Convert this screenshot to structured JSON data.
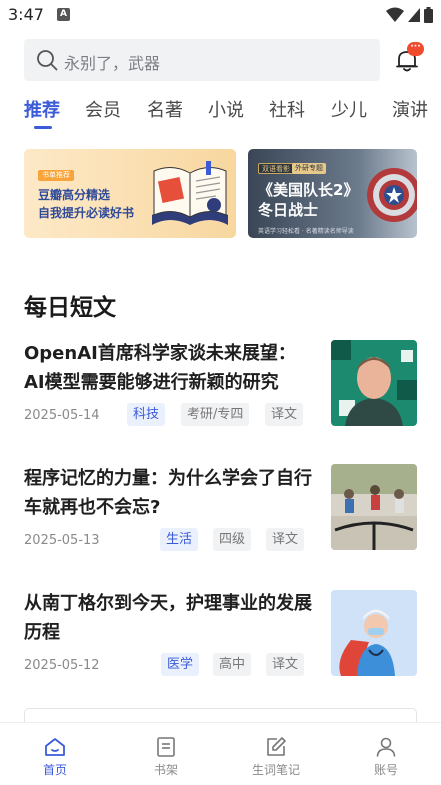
{
  "status_bar": {
    "time": "3:47",
    "notification_glyph": "A"
  },
  "search": {
    "placeholder": "永别了，武器"
  },
  "notification_badge": "···",
  "tabs": [
    {
      "label": "推荐",
      "active": true
    },
    {
      "label": "会员",
      "active": false
    },
    {
      "label": "名著",
      "active": false
    },
    {
      "label": "小说",
      "active": false
    },
    {
      "label": "社科",
      "active": false
    },
    {
      "label": "少儿",
      "active": false
    },
    {
      "label": "演讲",
      "active": false
    }
  ],
  "banners": [
    {
      "tag": "书单推荐",
      "line1": "豆瓣高分精选",
      "line2": "自我提升必读好书"
    },
    {
      "tag1": "双语看影",
      "tag2": "外研专题",
      "title_line1": "《美国队长2》",
      "title_line2": "冬日战士",
      "subtitle": "英语学习轻松看 · 名著精读名师导读"
    }
  ],
  "section": {
    "title": "每日短文"
  },
  "articles": [
    {
      "title": "OpenAI首席科学家谈未来展望：AI模型需要能够进行新颖的研究",
      "date": "2025-05-14",
      "tags": [
        "科技",
        "考研/专四",
        "译文"
      ]
    },
    {
      "title": "程序记忆的力量：为什么学会了自行车就再也不会忘?",
      "date": "2025-05-13",
      "tags": [
        "生活",
        "四级",
        "译文"
      ]
    },
    {
      "title": "从南丁格尔到今天，护理事业的发展历程",
      "date": "2025-05-12",
      "tags": [
        "医学",
        "高中",
        "译文"
      ]
    }
  ],
  "bottom_nav": [
    {
      "label": "首页",
      "icon": "home-icon",
      "active": true
    },
    {
      "label": "书架",
      "icon": "bookshelf-icon",
      "active": false
    },
    {
      "label": "生词笔记",
      "icon": "notes-edit-icon",
      "active": false
    },
    {
      "label": "账号",
      "icon": "account-icon",
      "active": false
    }
  ],
  "colors": {
    "accent": "#3b5bd9",
    "badge": "#f04a2f",
    "muted": "#8a8a8a"
  }
}
